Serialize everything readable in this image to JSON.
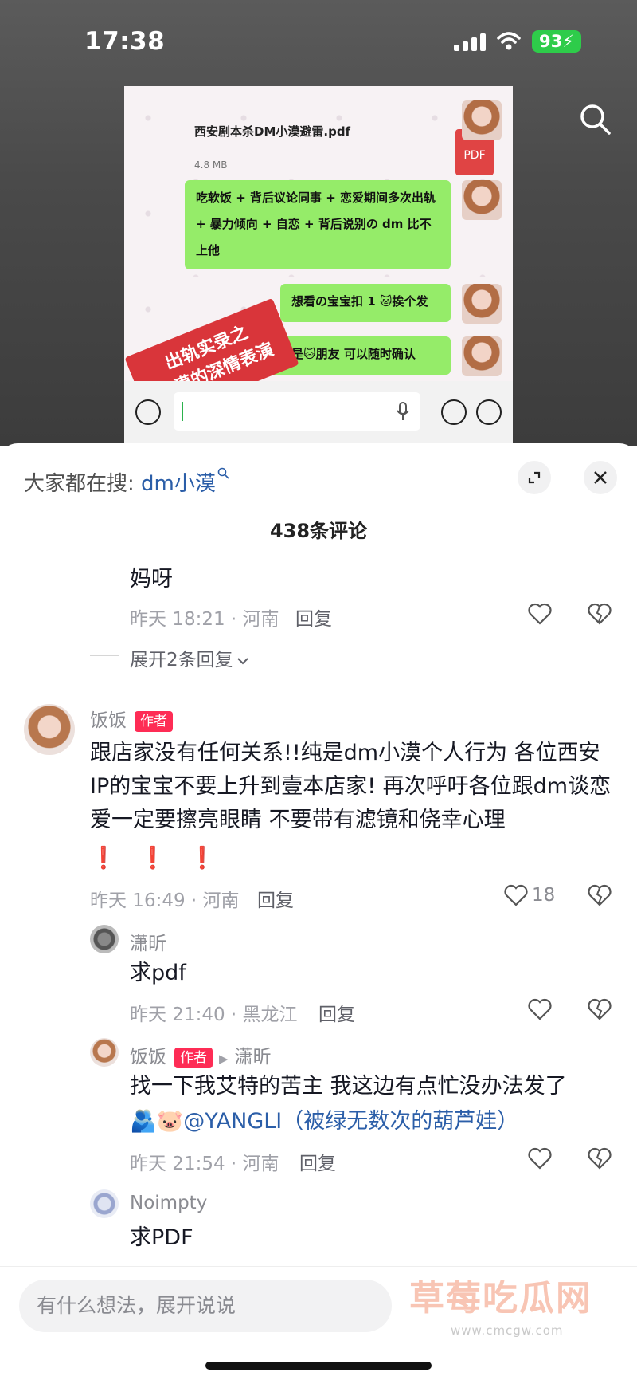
{
  "status_bar": {
    "time": "17:38",
    "battery": "93"
  },
  "video": {
    "file_name": "西安剧本杀DM小漠避雷.pdf",
    "file_size": "4.8 MB",
    "pdf_label": "PDF",
    "bubbles": [
      "吃软饭 + 背后议论同事 + 恋爱期间多次出轨+ 暴力倾向 + 自恋 + 背后说别の dm 比不上他",
      "想看の宝宝扣 1 🐱挨个发",
      "苦主是🐱朋友 可以随时确认"
    ],
    "stamp_line1": "出轨实录之",
    "stamp_line2": "小漠的深情表演"
  },
  "sheet": {
    "hot_search_prefix": "大家都在搜:",
    "hot_search_term": "dm小漠",
    "comment_count": "438条评论",
    "expand_replies": "展开2条回复",
    "reply_label": "回复",
    "input_placeholder": "有什么想法，展开说说"
  },
  "comments": [
    {
      "text": "妈呀",
      "meta": "昨天 18:21 · 河南"
    },
    {
      "name": "饭饭",
      "badge": "作者",
      "text": "跟店家没有任何关系!!纯是dm小漠个人行为 各位西安IP的宝宝不要上升到壹本店家! 再次呼吁各位跟dm谈恋爱一定要擦亮眼睛 不要带有滤镜和侥幸心理",
      "emoji": "❗ ❗ ❗",
      "meta": "昨天 16:49 · 河南",
      "likes": "18"
    },
    {
      "name": "潇昕",
      "text": "求pdf",
      "meta": "昨天 21:40 · 黑龙江"
    },
    {
      "name": "饭饭",
      "badge": "作者",
      "reply_to": "潇昕",
      "text": "找一下我艾特的苦主 我这边有点忙没办法发了",
      "emoji": "🫂🐷",
      "mention": "@YANGLI（被绿无数次的葫芦娃）",
      "meta": "昨天 21:54 · 河南"
    },
    {
      "name": "Noimpty",
      "text": "求PDF"
    }
  ],
  "watermark": {
    "text": "草莓吃瓜网",
    "url": "www.cmcgw.com"
  }
}
